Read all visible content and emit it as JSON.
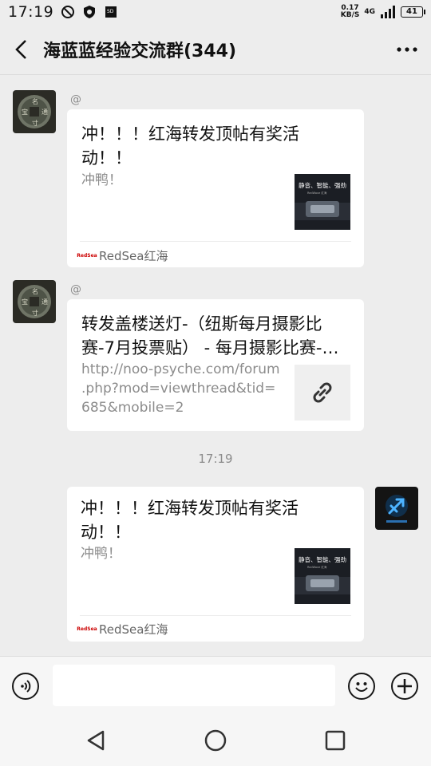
{
  "status_bar": {
    "time": "17:19",
    "net_speed_value": "0.17",
    "net_speed_unit": "KB/S",
    "network": "4G",
    "battery": "41"
  },
  "header": {
    "title": "海蓝蓝经验交流群(344)",
    "back_icon": "back-arrow-icon",
    "more_icon": "more-dots-icon"
  },
  "messages": [
    {
      "side": "left",
      "sender": "@",
      "card": {
        "title_line1": "冲！！！红海转发顶帖有奖活",
        "title_line2": "动！！",
        "desc": "冲鸭！",
        "thumb_text_1": "静音、智能、强劲",
        "thumb_text_2": "RedWave 红海",
        "source_logo": "RedSea",
        "source": "RedSea红海"
      }
    },
    {
      "side": "left",
      "sender": "@",
      "card": {
        "title_line1": "转发盖楼送灯-（纽斯每月摄影比",
        "title_line2": "赛-7月投票贴） - 每月摄影比赛-…",
        "desc_line1": "http://noo-psyche.com/forum",
        "desc_line2": ".php?mod=viewthread&tid=",
        "desc_line3": "685&mobile=2",
        "thumb_icon": "link-icon"
      }
    },
    {
      "side": "right",
      "card": {
        "title_line1": "冲！！！红海转发顶帖有奖活",
        "title_line2": "动！！",
        "desc": "冲鸭！",
        "thumb_text_1": "静音、智能、强劲",
        "thumb_text_2": "RedWave 红海",
        "source_logo": "RedSea",
        "source": "RedSea红海"
      }
    }
  ],
  "timestamp": "17:19",
  "input_bar": {
    "placeholder": "",
    "voice_icon": "voice-icon",
    "emoji_icon": "emoji-icon",
    "plus_icon": "plus-icon"
  },
  "nav_bar": {
    "back": "nav-back-icon",
    "home": "nav-home-icon",
    "recents": "nav-recents-icon"
  }
}
